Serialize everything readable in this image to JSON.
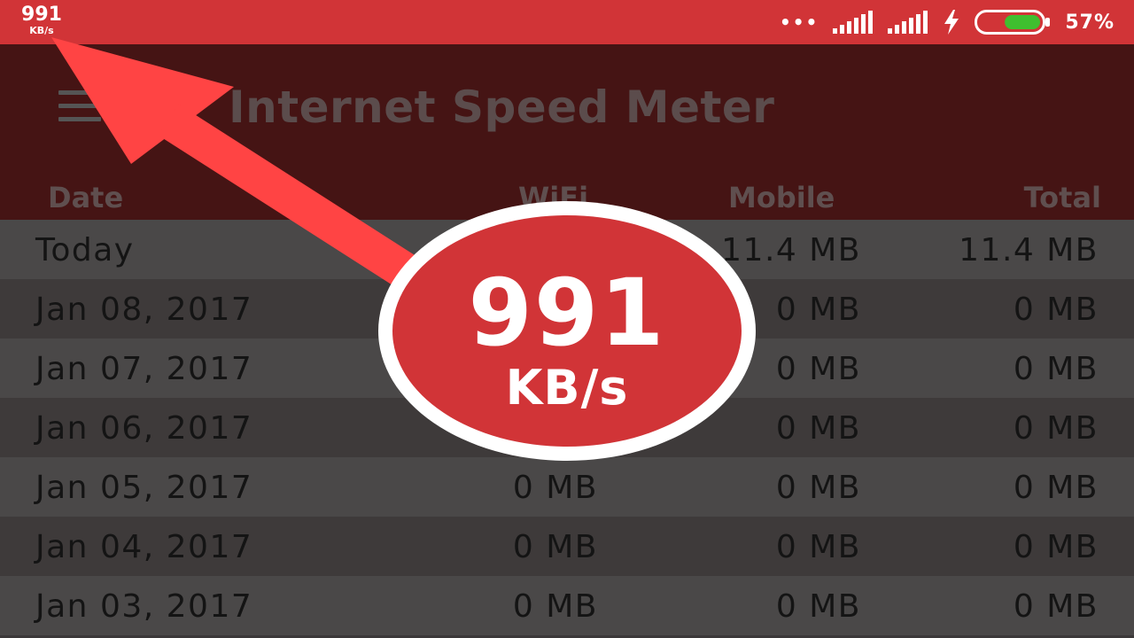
{
  "status_bar": {
    "speed_value": "991",
    "speed_unit": "KB/s",
    "dots": "•••",
    "battery_percent": "57%",
    "battery_level": 0.57,
    "icons": [
      "more-dots-icon",
      "signal-icon",
      "signal-icon",
      "charging-bolt-icon",
      "battery-icon"
    ]
  },
  "header": {
    "title": "Internet Speed Meter",
    "columns": {
      "date": "Date",
      "wifi": "WiFi",
      "mobile": "Mobile",
      "total": "Total"
    }
  },
  "rows": [
    {
      "date": "Today",
      "wifi": "",
      "mobile": "11.4 MB",
      "total": "11.4 MB"
    },
    {
      "date": "Jan 08, 2017",
      "wifi": "",
      "mobile": "0 MB",
      "total": "0 MB"
    },
    {
      "date": "Jan 07, 2017",
      "wifi": "",
      "mobile": "0 MB",
      "total": "0 MB"
    },
    {
      "date": "Jan 06, 2017",
      "wifi": "",
      "mobile": "0 MB",
      "total": "0 MB"
    },
    {
      "date": "Jan 05, 2017",
      "wifi": "0 MB",
      "mobile": "0 MB",
      "total": "0 MB"
    },
    {
      "date": "Jan 04, 2017",
      "wifi": "0 MB",
      "mobile": "0 MB",
      "total": "0 MB"
    },
    {
      "date": "Jan 03, 2017",
      "wifi": "0 MB",
      "mobile": "0 MB",
      "total": "0 MB"
    }
  ],
  "callout": {
    "value": "991",
    "unit": "KB/s"
  },
  "colors": {
    "accent": "#d13437",
    "toolbar": "#451414",
    "arrow": "#ff4444"
  }
}
